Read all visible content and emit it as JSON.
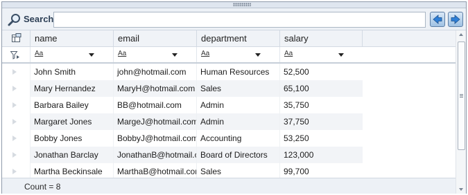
{
  "search": {
    "label": "Search",
    "value": ""
  },
  "columns": [
    "name",
    "email",
    "department",
    "salary"
  ],
  "filter_text": "Aa",
  "rows": [
    [
      "John Smith",
      "john@hotmail.com",
      "Human Resources",
      "52,500"
    ],
    [
      "Mary Hernandez",
      "MaryH@hotmail.com",
      "Sales",
      "65,100"
    ],
    [
      "Barbara Bailey",
      "BB@hotmail.com",
      "Admin",
      "35,750"
    ],
    [
      "Margaret Jones",
      "MargeJ@hotmail.com",
      "Admin",
      "37,750"
    ],
    [
      "Bobby Jones",
      "BobbyJ@hotmail.com",
      "Accounting",
      "53,250"
    ],
    [
      "Jonathan Barclay",
      "JonathanB@hotmail.com",
      "Board of Directors",
      "123,000"
    ],
    [
      "Martha Beckinsale",
      "MarthaB@hotmail.com",
      "Sales",
      "99,700"
    ]
  ],
  "status": {
    "count_label": "Count = 8"
  },
  "icons": {
    "search": "magnifier-icon",
    "prev": "arrow-left-icon",
    "next": "arrow-right-icon",
    "column_chooser": "column-chooser-icon",
    "filter": "filter-icon",
    "row_indicator": "row-indicator-icon"
  },
  "colors": {
    "accent": "#4a90d9",
    "header_bg": "#edf1f6",
    "alt_row": "#f2f4f7"
  }
}
